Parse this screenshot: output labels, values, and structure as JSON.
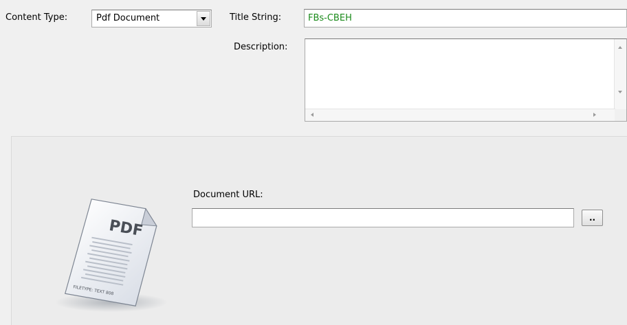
{
  "content_type": {
    "label": "Content Type:",
    "selected": "Pdf Document"
  },
  "title_string": {
    "label": "Title String:",
    "value": "FBs-CBEH"
  },
  "description": {
    "label": "Description:",
    "value": ""
  },
  "document_url": {
    "label": "Document URL:",
    "value": "",
    "browse_label": ".."
  },
  "pdf_icon": {
    "icon": "pdf-document-icon",
    "text": "PDF",
    "footer": "FILETYPE: TEXT 808"
  },
  "colors": {
    "title_value": "#1a8a1a",
    "background": "#f0f0f0"
  }
}
